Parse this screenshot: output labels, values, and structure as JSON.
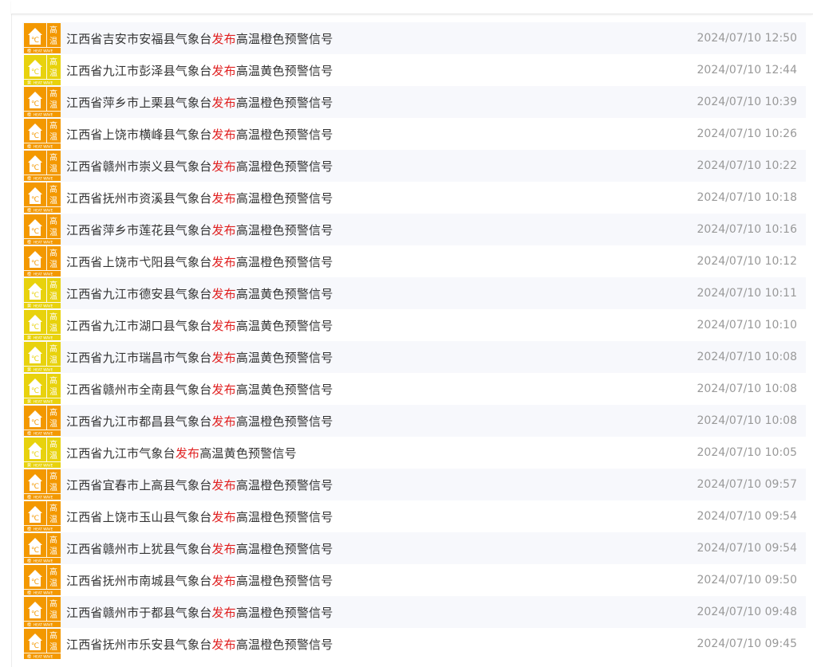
{
  "colors": {
    "orange_signal": "#f39800",
    "yellow_signal": "#e8d20d",
    "verb_highlight": "#e02020",
    "title_text": "#333333",
    "time_text": "#999999",
    "row_stripe": "#f7f8fc"
  },
  "icon_text": {
    "char_top": "高",
    "char_bottom": "温",
    "caption": "HEAT WAVE",
    "thermometer_glyph": "℃"
  },
  "alerts": [
    {
      "prefix": "江西省吉安市安福县气象台",
      "verb": "发布",
      "suffix": "高温橙色预警信号",
      "time": "2024/07/10 12:50",
      "level": "orange",
      "icon": "heat-wave-orange-icon",
      "level_char": "橙"
    },
    {
      "prefix": "江西省九江市彭泽县气象台",
      "verb": "发布",
      "suffix": "高温黄色预警信号",
      "time": "2024/07/10 12:44",
      "level": "yellow",
      "icon": "heat-wave-yellow-icon",
      "level_char": "黄"
    },
    {
      "prefix": "江西省萍乡市上栗县气象台",
      "verb": "发布",
      "suffix": "高温橙色预警信号",
      "time": "2024/07/10 10:39",
      "level": "orange",
      "icon": "heat-wave-orange-icon",
      "level_char": "橙"
    },
    {
      "prefix": "江西省上饶市横峰县气象台",
      "verb": "发布",
      "suffix": "高温橙色预警信号",
      "time": "2024/07/10 10:26",
      "level": "orange",
      "icon": "heat-wave-orange-icon",
      "level_char": "橙"
    },
    {
      "prefix": "江西省赣州市崇义县气象台",
      "verb": "发布",
      "suffix": "高温橙色预警信号",
      "time": "2024/07/10 10:22",
      "level": "orange",
      "icon": "heat-wave-orange-icon",
      "level_char": "橙"
    },
    {
      "prefix": "江西省抚州市资溪县气象台",
      "verb": "发布",
      "suffix": "高温橙色预警信号",
      "time": "2024/07/10 10:18",
      "level": "orange",
      "icon": "heat-wave-orange-icon",
      "level_char": "橙"
    },
    {
      "prefix": "江西省萍乡市莲花县气象台",
      "verb": "发布",
      "suffix": "高温橙色预警信号",
      "time": "2024/07/10 10:16",
      "level": "orange",
      "icon": "heat-wave-orange-icon",
      "level_char": "橙"
    },
    {
      "prefix": "江西省上饶市弋阳县气象台",
      "verb": "发布",
      "suffix": "高温橙色预警信号",
      "time": "2024/07/10 10:12",
      "level": "orange",
      "icon": "heat-wave-orange-icon",
      "level_char": "橙"
    },
    {
      "prefix": "江西省九江市德安县气象台",
      "verb": "发布",
      "suffix": "高温黄色预警信号",
      "time": "2024/07/10 10:11",
      "level": "yellow",
      "icon": "heat-wave-yellow-icon",
      "level_char": "黄"
    },
    {
      "prefix": "江西省九江市湖口县气象台",
      "verb": "发布",
      "suffix": "高温黄色预警信号",
      "time": "2024/07/10 10:10",
      "level": "yellow",
      "icon": "heat-wave-yellow-icon",
      "level_char": "黄"
    },
    {
      "prefix": "江西省九江市瑞昌市气象台",
      "verb": "发布",
      "suffix": "高温黄色预警信号",
      "time": "2024/07/10 10:08",
      "level": "yellow",
      "icon": "heat-wave-yellow-icon",
      "level_char": "黄"
    },
    {
      "prefix": "江西省赣州市全南县气象台",
      "verb": "发布",
      "suffix": "高温黄色预警信号",
      "time": "2024/07/10 10:08",
      "level": "yellow",
      "icon": "heat-wave-yellow-icon",
      "level_char": "黄"
    },
    {
      "prefix": "江西省九江市都昌县气象台",
      "verb": "发布",
      "suffix": "高温橙色预警信号",
      "time": "2024/07/10 10:08",
      "level": "orange",
      "icon": "heat-wave-orange-icon",
      "level_char": "橙"
    },
    {
      "prefix": "江西省九江市气象台",
      "verb": "发布",
      "suffix": "高温黄色预警信号",
      "time": "2024/07/10 10:05",
      "level": "yellow",
      "icon": "heat-wave-yellow-icon",
      "level_char": "黄"
    },
    {
      "prefix": "江西省宜春市上高县气象台",
      "verb": "发布",
      "suffix": "高温橙色预警信号",
      "time": "2024/07/10 09:57",
      "level": "orange",
      "icon": "heat-wave-orange-icon",
      "level_char": "橙"
    },
    {
      "prefix": "江西省上饶市玉山县气象台",
      "verb": "发布",
      "suffix": "高温橙色预警信号",
      "time": "2024/07/10 09:54",
      "level": "orange",
      "icon": "heat-wave-orange-icon",
      "level_char": "橙"
    },
    {
      "prefix": "江西省赣州市上犹县气象台",
      "verb": "发布",
      "suffix": "高温橙色预警信号",
      "time": "2024/07/10 09:54",
      "level": "orange",
      "icon": "heat-wave-orange-icon",
      "level_char": "橙"
    },
    {
      "prefix": "江西省抚州市南城县气象台",
      "verb": "发布",
      "suffix": "高温橙色预警信号",
      "time": "2024/07/10 09:50",
      "level": "orange",
      "icon": "heat-wave-orange-icon",
      "level_char": "橙"
    },
    {
      "prefix": "江西省赣州市于都县气象台",
      "verb": "发布",
      "suffix": "高温橙色预警信号",
      "time": "2024/07/10 09:48",
      "level": "orange",
      "icon": "heat-wave-orange-icon",
      "level_char": "橙"
    },
    {
      "prefix": "江西省抚州市乐安县气象台",
      "verb": "发布",
      "suffix": "高温橙色预警信号",
      "time": "2024/07/10 09:45",
      "level": "orange",
      "icon": "heat-wave-orange-icon",
      "level_char": "橙"
    }
  ]
}
